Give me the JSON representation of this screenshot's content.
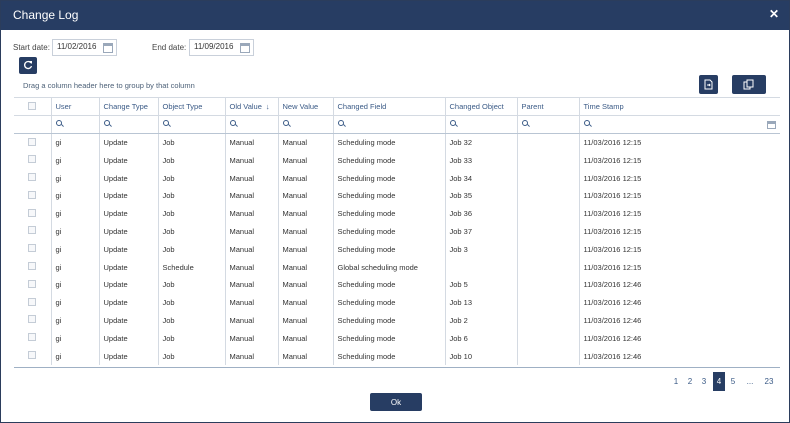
{
  "dialog": {
    "title": "Change Log",
    "close_symbol": "✕"
  },
  "filters": {
    "start_label": "Start date:",
    "start_value": "11/02/2016",
    "end_label": "End date:",
    "end_value": "11/09/2016"
  },
  "group_hint": "Drag a column header here to group by that column",
  "columns": [
    "User",
    "Change Type",
    "Object Type",
    "Old Value",
    "New Value",
    "Changed Field",
    "Changed Object",
    "Parent",
    "Time Stamp"
  ],
  "sorted_column": "Old Value",
  "rows": [
    [
      "gi",
      "Update",
      "Job",
      "Manual",
      "Manual",
      "Scheduling mode",
      "Job 32",
      "",
      "11/03/2016 12:15"
    ],
    [
      "gi",
      "Update",
      "Job",
      "Manual",
      "Manual",
      "Scheduling mode",
      "Job 33",
      "",
      "11/03/2016 12:15"
    ],
    [
      "gi",
      "Update",
      "Job",
      "Manual",
      "Manual",
      "Scheduling mode",
      "Job 34",
      "",
      "11/03/2016 12:15"
    ],
    [
      "gi",
      "Update",
      "Job",
      "Manual",
      "Manual",
      "Scheduling mode",
      "Job 35",
      "",
      "11/03/2016 12:15"
    ],
    [
      "gi",
      "Update",
      "Job",
      "Manual",
      "Manual",
      "Scheduling mode",
      "Job 36",
      "",
      "11/03/2016 12:15"
    ],
    [
      "gi",
      "Update",
      "Job",
      "Manual",
      "Manual",
      "Scheduling mode",
      "Job 37",
      "",
      "11/03/2016 12:15"
    ],
    [
      "gi",
      "Update",
      "Job",
      "Manual",
      "Manual",
      "Scheduling mode",
      "Job 3",
      "",
      "11/03/2016 12:15"
    ],
    [
      "gi",
      "Update",
      "Schedule",
      "Manual",
      "Manual",
      "Global scheduling mode",
      "",
      "",
      "11/03/2016 12:15"
    ],
    [
      "gi",
      "Update",
      "Job",
      "Manual",
      "Manual",
      "Scheduling mode",
      "Job 5",
      "",
      "11/03/2016 12:46"
    ],
    [
      "gi",
      "Update",
      "Job",
      "Manual",
      "Manual",
      "Scheduling mode",
      "Job 13",
      "",
      "11/03/2016 12:46"
    ],
    [
      "gi",
      "Update",
      "Job",
      "Manual",
      "Manual",
      "Scheduling mode",
      "Job 2",
      "",
      "11/03/2016 12:46"
    ],
    [
      "gi",
      "Update",
      "Job",
      "Manual",
      "Manual",
      "Scheduling mode",
      "Job 6",
      "",
      "11/03/2016 12:46"
    ],
    [
      "gi",
      "Update",
      "Job",
      "Manual",
      "Manual",
      "Scheduling mode",
      "Job 10",
      "",
      "11/03/2016 12:46"
    ]
  ],
  "pager": {
    "pages": [
      "1",
      "2",
      "3",
      "4",
      "5",
      "...",
      "23"
    ],
    "current": "4"
  },
  "ok_label": "Ok",
  "icons": {
    "refresh": "refresh-icon",
    "export": "export-icon",
    "column_chooser": "column-chooser-icon",
    "calendar": "calendar-icon",
    "search": "search-icon"
  },
  "colors": {
    "primary": "#273d63",
    "header_text": "#3a5a86"
  }
}
